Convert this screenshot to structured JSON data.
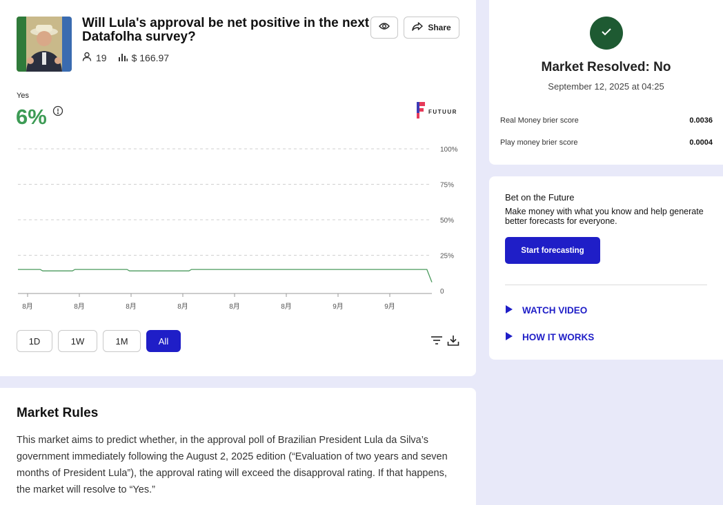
{
  "market": {
    "title": "Will Lula's approval be net positive in the next Datafolha survey?",
    "participants": "19",
    "volume": "$ 166.97",
    "share_label": "Share",
    "outcome_label": "Yes",
    "probability": "6%",
    "brand": "FUTUUR"
  },
  "chart_data": {
    "type": "line",
    "x": [
      "8月",
      "8月",
      "8月",
      "8月",
      "8月",
      "8月",
      "9月",
      "9月"
    ],
    "y_ticks": [
      "100%",
      "75%",
      "50%",
      "25%",
      "0"
    ],
    "ylim": [
      0,
      100
    ],
    "grid": true,
    "series": [
      {
        "color": "#4a9a5c",
        "points": [
          [
            0,
            15
          ],
          [
            0.9,
            15
          ],
          [
            1.0,
            14
          ],
          [
            2.2,
            14
          ],
          [
            2.3,
            15
          ],
          [
            4.4,
            15
          ],
          [
            4.5,
            14
          ],
          [
            6.9,
            14
          ],
          [
            7.0,
            15
          ],
          [
            16.5,
            15
          ],
          [
            16.7,
            6
          ]
        ]
      }
    ]
  },
  "ranges": [
    "1D",
    "1W",
    "1M",
    "All"
  ],
  "active_range": "All",
  "rules": {
    "title": "Market Rules",
    "text": "This market aims to predict whether, in the approval poll of Brazilian President Lula da Silva’s government immediately following the August 2, 2025 edition (“Evaluation of two years and seven months of President Lula”), the approval rating will exceed the disapproval rating. If that happens, the market will resolve to “Yes.”"
  },
  "resolution": {
    "title": "Market Resolved: No",
    "date": "September 12, 2025 at 04:25",
    "scores": [
      {
        "label": "Real Money brier score",
        "value": "0.0036"
      },
      {
        "label": "Play money brier score",
        "value": "0.0004"
      }
    ]
  },
  "promo": {
    "title": "Bet on the Future",
    "description": "Make money with what you know and help generate better forecasts for everyone.",
    "cta": "Start forecasting",
    "links": [
      "WATCH VIDEO",
      "HOW IT WORKS"
    ]
  },
  "colors": {
    "accent": "#1f1ec7",
    "positive": "#3d9b55",
    "resolved": "#1e5a32",
    "background": "#e8e9f9"
  }
}
